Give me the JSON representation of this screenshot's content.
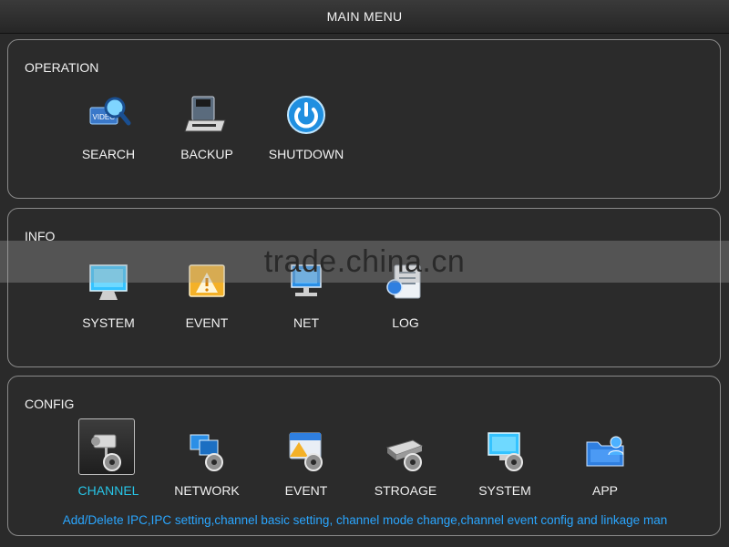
{
  "window": {
    "title": "MAIN MENU"
  },
  "operation": {
    "title": "OPERATION",
    "items": [
      {
        "label": "SEARCH",
        "icon": "video-search-icon"
      },
      {
        "label": "BACKUP",
        "icon": "backup-drive-icon"
      },
      {
        "label": "SHUTDOWN",
        "icon": "power-icon"
      }
    ]
  },
  "info": {
    "title": "INFO",
    "items": [
      {
        "label": "SYSTEM",
        "icon": "monitor-icon"
      },
      {
        "label": "EVENT",
        "icon": "alert-icon"
      },
      {
        "label": "NET",
        "icon": "network-monitor-icon"
      },
      {
        "label": "LOG",
        "icon": "log-document-icon"
      }
    ]
  },
  "config": {
    "title": "CONFIG",
    "selected": "CHANNEL",
    "items": [
      {
        "label": "CHANNEL",
        "icon": "camera-gear-icon"
      },
      {
        "label": "NETWORK",
        "icon": "network-gear-icon"
      },
      {
        "label": "EVENT",
        "icon": "alert-gear-icon"
      },
      {
        "label": "STROAGE",
        "icon": "hdd-gear-icon"
      },
      {
        "label": "SYSTEM",
        "icon": "monitor-gear-icon"
      },
      {
        "label": "APP",
        "icon": "folder-user-icon"
      }
    ],
    "status_text": "Add/Delete IPC,IPC setting,channel basic setting, channel mode change,channel event config and linkage man"
  },
  "watermark": "trade.china.cn",
  "colors": {
    "accent": "#27c6e8",
    "status": "#2aa6ff",
    "background": "#2a2a2a"
  }
}
